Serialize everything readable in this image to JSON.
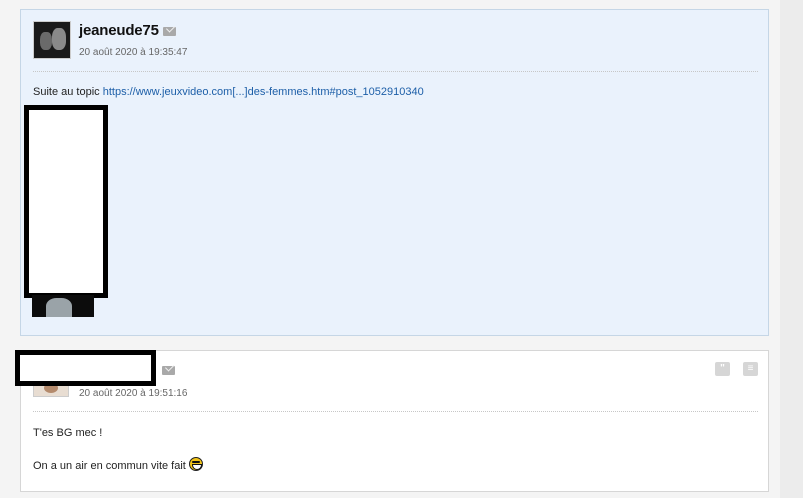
{
  "posts": [
    {
      "author": "jeaneude75",
      "date": "20 août 2020 à 19:35:47",
      "text_prefix": "Suite au topic ",
      "link": "https://www.jeuxvideo.com[...]des-femmes.htm#post_1052910340"
    },
    {
      "author": "",
      "date": "20 août 2020 à 19:51:16",
      "line1": "T'es BG mec !",
      "line2": "On a un air en commun vite fait"
    }
  ],
  "icons": {
    "mail": "envelope-icon",
    "quote": "quote-icon",
    "report": "report-icon",
    "smiley": "laughing-smiley-icon"
  },
  "colors": {
    "post_highlight_bg": "#eaf2fc",
    "post_bg": "#ffffff",
    "link": "#1d5fa8",
    "border": "#c5d6e6"
  }
}
